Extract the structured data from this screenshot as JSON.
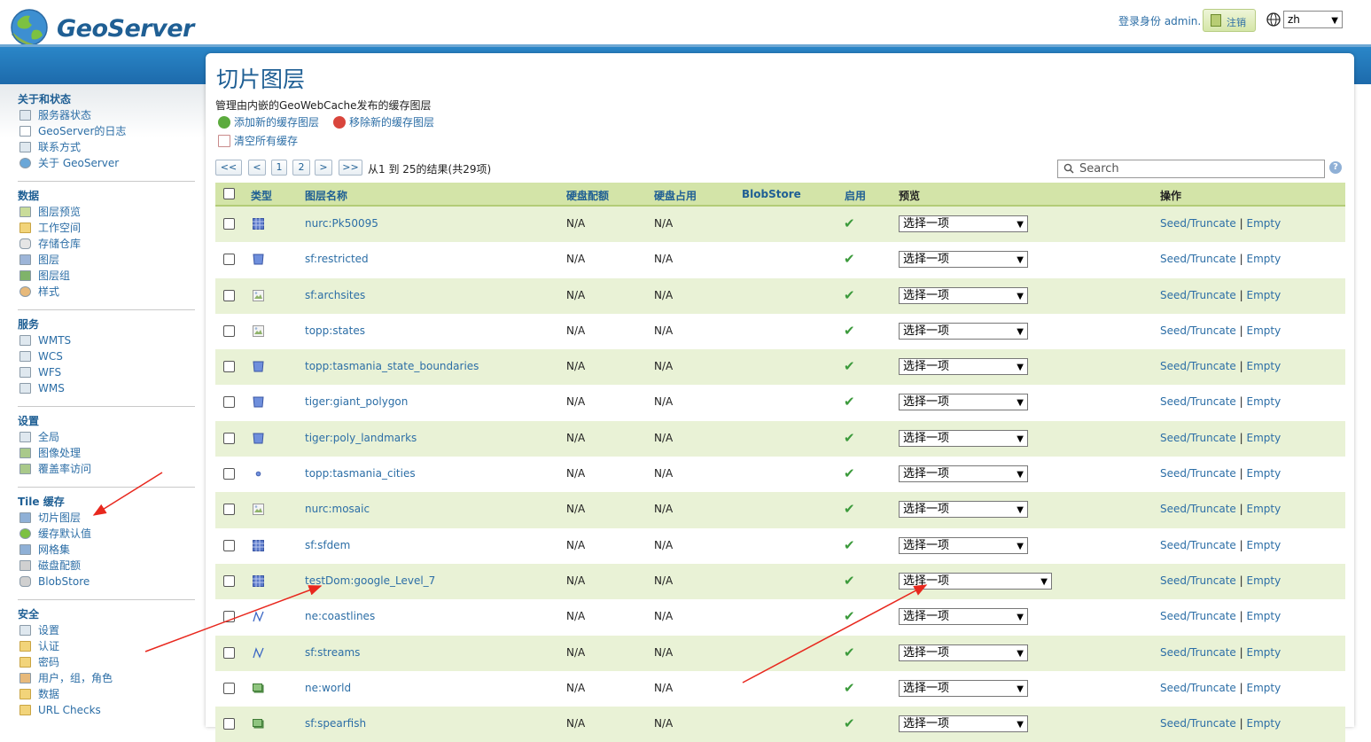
{
  "header": {
    "logo_text": "GeoServer",
    "login_info": "登录身份 admin.",
    "logout_label": "注销",
    "language": "zh"
  },
  "sidebar": {
    "sections": [
      {
        "title": "关于和状态",
        "items": [
          "服务器状态",
          "GeoServer的日志",
          "联系方式",
          "关于 GeoServer"
        ]
      },
      {
        "title": "数据",
        "items": [
          "图层预览",
          "工作空间",
          "存储仓库",
          "图层",
          "图层组",
          "样式"
        ]
      },
      {
        "title": "服务",
        "items": [
          "WMTS",
          "WCS",
          "WFS",
          "WMS"
        ]
      },
      {
        "title": "设置",
        "items": [
          "全局",
          "图像处理",
          "覆盖率访问"
        ]
      },
      {
        "title": "Tile 缓存",
        "items": [
          "切片图层",
          "缓存默认值",
          "网格集",
          "磁盘配额",
          "BlobStore"
        ]
      },
      {
        "title": "安全",
        "items": [
          "设置",
          "认证",
          "密码",
          "用户，组，角色",
          "数据",
          "URL Checks"
        ]
      }
    ]
  },
  "main": {
    "title": "切片图层",
    "description": "管理由内嵌的GeoWebCache发布的缓存图层",
    "add_layer": "添加新的缓存图层",
    "remove_layer": "移除新的缓存图层",
    "clear_cache": "清空所有缓存",
    "pager": {
      "first": "<<",
      "prev": "<",
      "page1": "1",
      "page2": "2",
      "next": ">",
      "last": ">>",
      "info": "从1 到 25的结果(共29项)"
    },
    "search_placeholder": "Search"
  },
  "table": {
    "headers": {
      "type": "类型",
      "name": "图层名称",
      "quota": "硬盘配额",
      "usage": "硬盘占用",
      "blobstore": "BlobStore",
      "enabled": "启用",
      "preview": "预览",
      "actions": "操作"
    },
    "preview_default": "选择一项",
    "seed_label": "Seed/Truncate",
    "sep": "|",
    "empty_label": "Empty",
    "rows": [
      {
        "name": "nurc:Pk50095",
        "quota": "N/A",
        "usage": "N/A",
        "type_icon": "raster-icon"
      },
      {
        "name": "sf:restricted",
        "quota": "N/A",
        "usage": "N/A",
        "type_icon": "polygon-icon"
      },
      {
        "name": "sf:archsites",
        "quota": "N/A",
        "usage": "N/A",
        "type_icon": "broken-image-icon"
      },
      {
        "name": "topp:states",
        "quota": "N/A",
        "usage": "N/A",
        "type_icon": "broken-image-icon"
      },
      {
        "name": "topp:tasmania_state_boundaries",
        "quota": "N/A",
        "usage": "N/A",
        "type_icon": "polygon-icon"
      },
      {
        "name": "tiger:giant_polygon",
        "quota": "N/A",
        "usage": "N/A",
        "type_icon": "polygon-icon"
      },
      {
        "name": "tiger:poly_landmarks",
        "quota": "N/A",
        "usage": "N/A",
        "type_icon": "polygon-icon"
      },
      {
        "name": "topp:tasmania_cities",
        "quota": "N/A",
        "usage": "N/A",
        "type_icon": "point-icon"
      },
      {
        "name": "nurc:mosaic",
        "quota": "N/A",
        "usage": "N/A",
        "type_icon": "broken-image-icon"
      },
      {
        "name": "sf:sfdem",
        "quota": "N/A",
        "usage": "N/A",
        "type_icon": "raster-icon"
      },
      {
        "name": "testDom:google_Level_7",
        "quota": "N/A",
        "usage": "N/A",
        "type_icon": "raster-icon"
      },
      {
        "name": "ne:coastlines",
        "quota": "N/A",
        "usage": "N/A",
        "type_icon": "line-icon"
      },
      {
        "name": "sf:streams",
        "quota": "N/A",
        "usage": "N/A",
        "type_icon": "line-icon"
      },
      {
        "name": "ne:world",
        "quota": "N/A",
        "usage": "N/A",
        "type_icon": "layergroup-icon"
      },
      {
        "name": "sf:spearfish",
        "quota": "N/A",
        "usage": "N/A",
        "type_icon": "layergroup-icon"
      }
    ]
  },
  "colors": {
    "brand_blue": "#1f5f94",
    "link_blue": "#2c6ea6",
    "header_green": "#d3e4a8",
    "row_alt": "#e9f2d6",
    "annotation_red": "#e8281e"
  }
}
